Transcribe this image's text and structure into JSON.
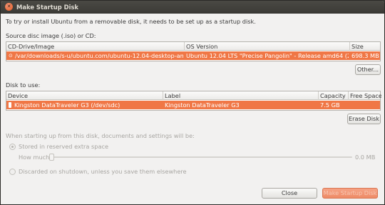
{
  "window": {
    "title": "Make Startup Disk",
    "close_glyph": "✕"
  },
  "intro": "To try or install Ubuntu from a removable disk, it needs to be set up as a startup disk.",
  "source": {
    "label": "Source disc image (.iso) or CD:",
    "columns": [
      "CD-Drive/Image",
      "OS Version",
      "Size"
    ],
    "rows": [
      {
        "image": "/var/downloads/s-u/ubuntu.com/ubuntu-12.04-desktop-am…",
        "os_version": "Ubuntu 12.04 LTS \"Precise Pangolin\" - Release amd64 (201…",
        "size": "698.3 MB"
      }
    ],
    "other_button": "Other..."
  },
  "disk": {
    "label": "Disk to use:",
    "columns": [
      "Device",
      "Label",
      "Capacity",
      "Free Space"
    ],
    "rows": [
      {
        "device": "Kingston DataTraveler G3 (/dev/sdc)",
        "label": "Kingston DataTraveler G3",
        "capacity": "7.5 GB",
        "free_space": ""
      }
    ],
    "erase_button": "Erase Disk"
  },
  "startup": {
    "heading": "When starting up from this disk, documents and settings will be:",
    "option_stored": "Stored in reserved extra space",
    "how_much_label": "How much:",
    "how_much_value": "0.0 MB",
    "how_much_level": 0,
    "option_discarded": "Discarded on shutdown, unless you save them elsewhere"
  },
  "actions": {
    "close": "Close",
    "make": "Make Startup Disk"
  },
  "colors": {
    "selection": "#f07746",
    "titlebar": "#3c3b37",
    "window_bg": "#f2f1f0"
  }
}
